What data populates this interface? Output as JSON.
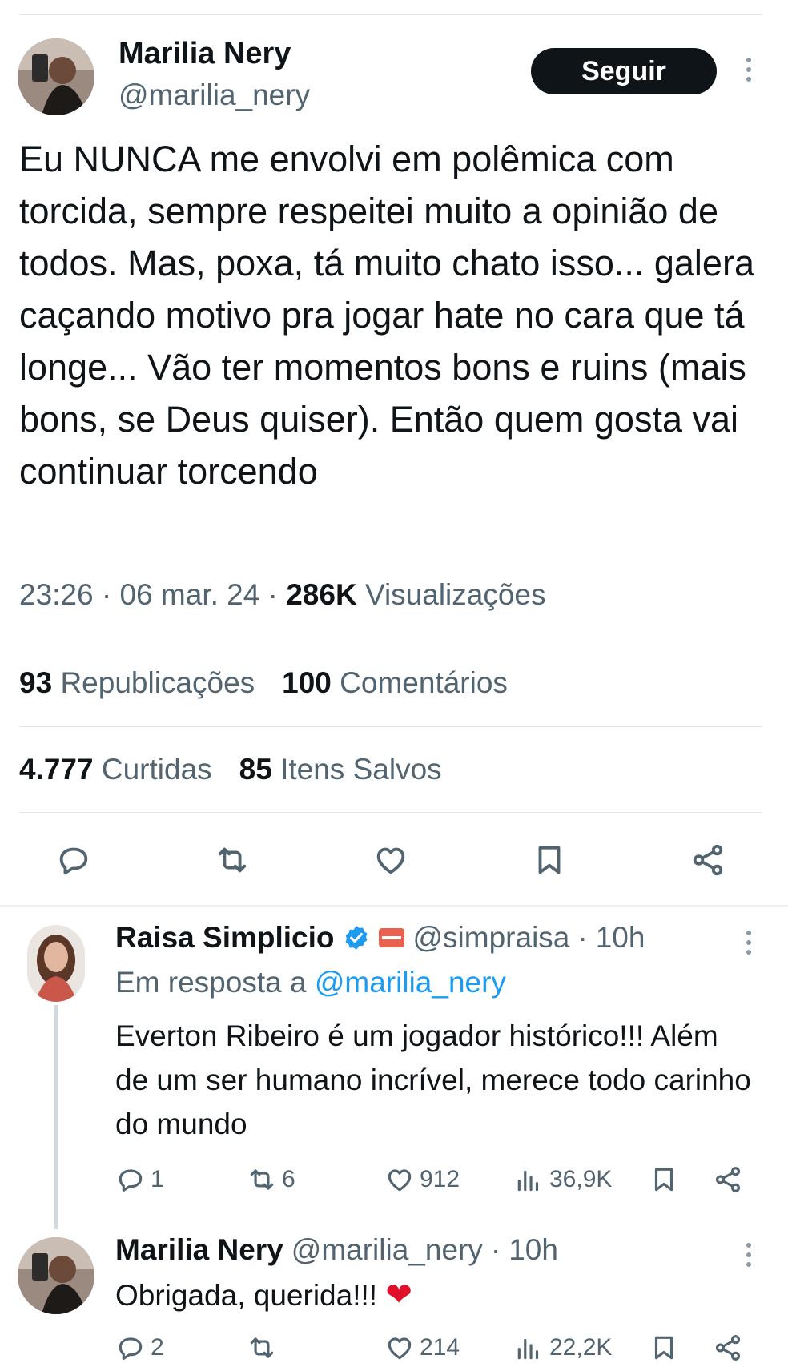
{
  "main_tweet": {
    "author_name": "Marilia Nery",
    "handle": "@marilia_nery",
    "follow_label": "Seguir",
    "text": "Eu NUNCA me envolvi em polêmica com torcida, sempre respeitei muito a opinião de todos. Mas, poxa, tá muito chato isso... galera caçando motivo pra jogar hate no cara que tá longe... Vão ter momentos bons e ruins (mais bons, se Deus quiser). Então quem gosta vai continuar torcendo",
    "time": "23:26",
    "date": "06 mar. 24",
    "views_count": "286K",
    "views_label": "Visualizações",
    "reposts_count": "93",
    "reposts_label": "Republicações",
    "comments_count": "100",
    "comments_label": "Comentários",
    "likes_count": "4.777",
    "likes_label": "Curtidas",
    "saves_count": "85",
    "saves_label": "Itens Salvos",
    "actions": [
      "reply-icon",
      "retweet-icon",
      "heart-icon",
      "bookmark-icon",
      "share-icon"
    ]
  },
  "reply_1": {
    "author_name": "Raisa Simplicio",
    "handle": "@simpraisa",
    "age": "10h",
    "in_reply_prefix": "Em resposta a",
    "in_reply_handle": "@marilia_nery",
    "text": "Everton Ribeiro é um jogador histórico!!! Além de um ser humano incrível, merece todo carinho do mundo",
    "replies": "1",
    "reposts": "6",
    "likes": "912",
    "views": "36,9K",
    "verified_color": "#1d9bf0"
  },
  "reply_2": {
    "author_name": "Marilia Nery",
    "handle": "@marilia_nery",
    "age": "10h",
    "text": "Obrigada, querida!!!",
    "emoji": "❤",
    "replies": "2",
    "reposts": "",
    "likes": "214",
    "views": "22,2K"
  },
  "colors": {
    "text": "#0f1419",
    "muted": "#536471",
    "link": "#1d9bf0",
    "button_bg": "#0f1419"
  }
}
